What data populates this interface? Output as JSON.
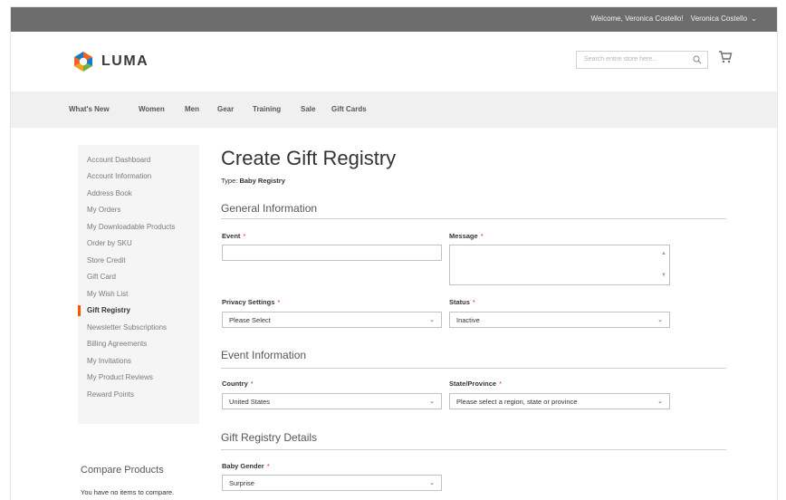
{
  "topbar": {
    "welcome": "Welcome, Veronica Costello!",
    "account_name": "Veronica Costello",
    "chevron": "⌄"
  },
  "header": {
    "logo_text": "LUMA",
    "search_placeholder": "Search entire store here...",
    "icons": [
      "search-icon",
      "cart-icon"
    ]
  },
  "nav": {
    "items": [
      "What's New",
      "Women",
      "Men",
      "Gear",
      "Training",
      "Sale",
      "Gift Cards"
    ]
  },
  "sidebar": {
    "items": [
      "Account Dashboard",
      "Account Information",
      "Address Book",
      "My Orders",
      "My Downloadable Products",
      "Order by SKU",
      "Store Credit",
      "Gift Card",
      "My Wish List",
      "Gift Registry",
      "Newsletter Subscriptions",
      "Billing Agreements",
      "My Invitations",
      "My Product Reviews",
      "Reward Points"
    ],
    "active_index": 9,
    "active_color": "#ff5501"
  },
  "compare": {
    "title": "Compare Products",
    "text": "You have no items to compare."
  },
  "main": {
    "page_title": "Create Gift Registry",
    "type_label": "Type:",
    "type_value": "Baby Registry",
    "sections": {
      "general": "General Information",
      "event": "Event Information",
      "details": "Gift Registry Details"
    },
    "fields": {
      "event_label": "Event",
      "message_label": "Message",
      "privacy_label": "Privacy Settings",
      "privacy_value": "Please Select",
      "status_label": "Status",
      "status_value": "Inactive",
      "country_label": "Country",
      "country_value": "United States",
      "state_label": "State/Province",
      "state_value": "Please select a region, state or province",
      "baby_gender_label": "Baby Gender",
      "baby_gender_value": "Surprise"
    },
    "required_marker": "*"
  }
}
